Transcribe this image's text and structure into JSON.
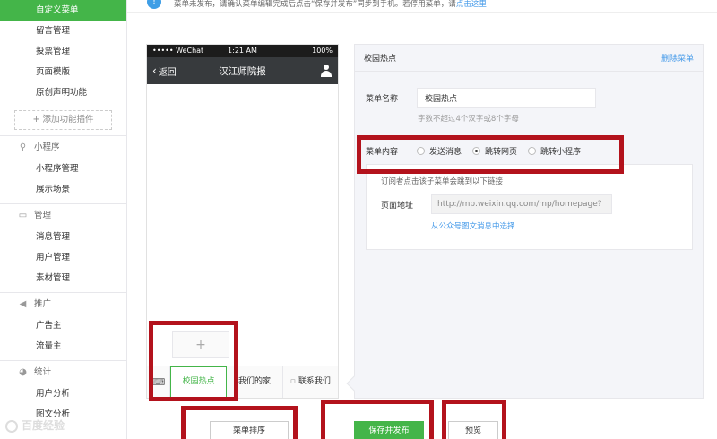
{
  "notice": {
    "text": "菜单未发布，请确认菜单编辑完成后点击“保存并发布”同步到手机。若停用菜单，请",
    "link": "点击这里"
  },
  "sidebar": {
    "items_top": [
      {
        "label": "自定义菜单",
        "active": true
      },
      {
        "label": "留言管理"
      },
      {
        "label": "投票管理"
      },
      {
        "label": "页面模版"
      },
      {
        "label": "原创声明功能"
      }
    ],
    "add_plugin": "+ 添加功能插件",
    "groups": [
      {
        "label": "小程序",
        "icon": "link-icon",
        "items": [
          "小程序管理",
          "展示场景"
        ]
      },
      {
        "label": "管理",
        "icon": "inbox-icon",
        "items": [
          "消息管理",
          "用户管理",
          "素材管理"
        ]
      },
      {
        "label": "推广",
        "icon": "megaphone-icon",
        "items": [
          "广告主",
          "流量主"
        ]
      },
      {
        "label": "统计",
        "icon": "pie-chart-icon",
        "items": [
          "用户分析",
          "图文分析"
        ]
      }
    ]
  },
  "phone": {
    "carrier": "••••• WeChat",
    "time": "1:21 AM",
    "battery": "100%",
    "back": "返回",
    "title": "汉江师院报",
    "sub_add": "+",
    "menus": [
      "校园热点",
      "我们的家",
      "联系我们"
    ]
  },
  "editor": {
    "heading": "校园热点",
    "delete": "删除菜单",
    "name_label": "菜单名称",
    "name_value": "校园热点",
    "name_hint": "字数不超过4个汉字或8个字母",
    "content_label": "菜单内容",
    "options": [
      {
        "label": "发送消息",
        "selected": false
      },
      {
        "label": "跳转网页",
        "selected": true
      },
      {
        "label": "跳转小程序",
        "selected": false
      }
    ],
    "box_desc": "订阅者点击该子菜单会跳到以下链接",
    "url_label": "页面地址",
    "url_value": "http://mp.weixin.qq.com/mp/homepage?",
    "choose_link": "从公众号图文消息中选择"
  },
  "buttons": {
    "sort": "菜单排序",
    "save": "保存并发布",
    "preview": "预览"
  },
  "colors": {
    "accent": "#44b549",
    "link": "#459ae9",
    "highlight": "#b3121c"
  }
}
